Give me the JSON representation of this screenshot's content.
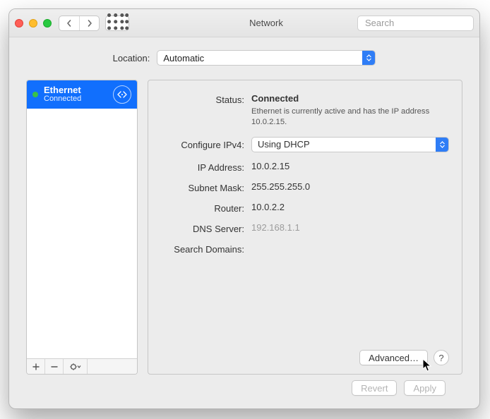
{
  "window": {
    "title": "Network"
  },
  "toolbar": {
    "search_placeholder": "Search"
  },
  "location": {
    "label": "Location:",
    "value": "Automatic"
  },
  "sidebar": {
    "items": [
      {
        "name": "Ethernet",
        "status": "Connected",
        "active": true,
        "dot_color": "#39c24a",
        "icon": "ethernet"
      }
    ],
    "footer": {
      "add": "+",
      "remove": "−",
      "action": "gear"
    }
  },
  "details": {
    "status_label": "Status:",
    "status_value": "Connected",
    "status_desc": "Ethernet is currently active and has the IP address 10.0.2.15.",
    "config_label": "Configure IPv4:",
    "config_value": "Using DHCP",
    "ip_label": "IP Address:",
    "ip_value": "10.0.2.15",
    "mask_label": "Subnet Mask:",
    "mask_value": "255.255.255.0",
    "router_label": "Router:",
    "router_value": "10.0.2.2",
    "dns_label": "DNS Server:",
    "dns_value": "192.168.1.1",
    "search_label": "Search Domains:",
    "search_value": "",
    "advanced_label": "Advanced…",
    "help_label": "?"
  },
  "footer": {
    "revert": "Revert",
    "apply": "Apply"
  }
}
